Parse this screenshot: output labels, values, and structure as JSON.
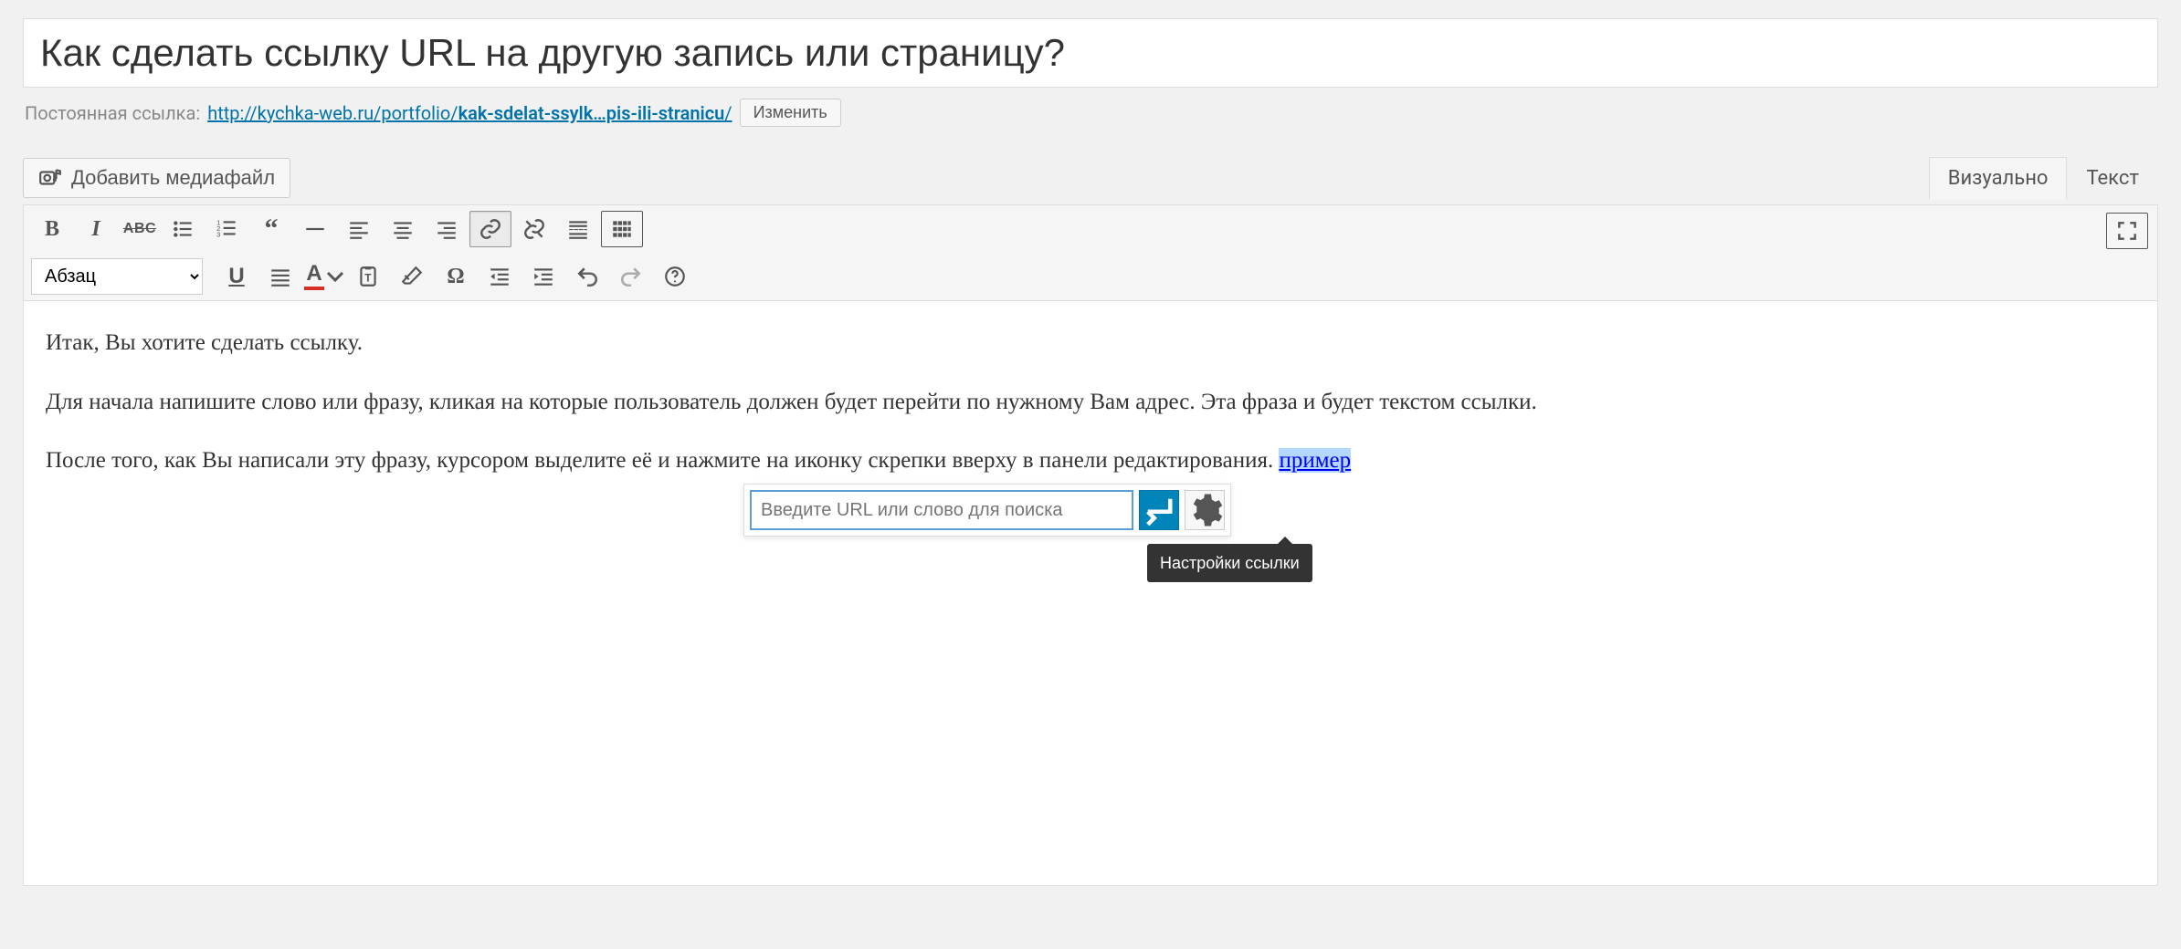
{
  "title": "Как сделать ссылку URL на другую запись или страницу?",
  "permalink": {
    "label": "Постоянная ссылка:",
    "base": "http://kychka-web.ru/portfolio/",
    "slug": "kak-sdelat-ssylk…pis-ili-stranicu",
    "edit_btn": "Изменить"
  },
  "media_button": "Добавить медиафайл",
  "tabs": {
    "visual": "Визуально",
    "text": "Текст"
  },
  "format_select": "Абзац",
  "content": {
    "p1": "Итак, Вы хотите сделать ссылку.",
    "p2": "Для начала напишите слово или фразу, кликая на которые пользователь должен будет перейти по нужному Вам адрес. Эта фраза и будет текстом ссылки.",
    "p3_prefix": "После того, как Вы написали эту фразу, курсором выделите её и нажмите на иконку скрепки вверху в панели редактирования. ",
    "p3_link": "пример"
  },
  "link_popup": {
    "placeholder": "Введите URL или слово для поиска",
    "tooltip": "Настройки ссылки"
  },
  "icons": {
    "bold": "B",
    "italic": "I",
    "underline": "U",
    "textcolor": "A",
    "omega": "Ω",
    "ul": "list-ul",
    "ol": "list-ol",
    "quote": "quote",
    "hr": "hr"
  }
}
